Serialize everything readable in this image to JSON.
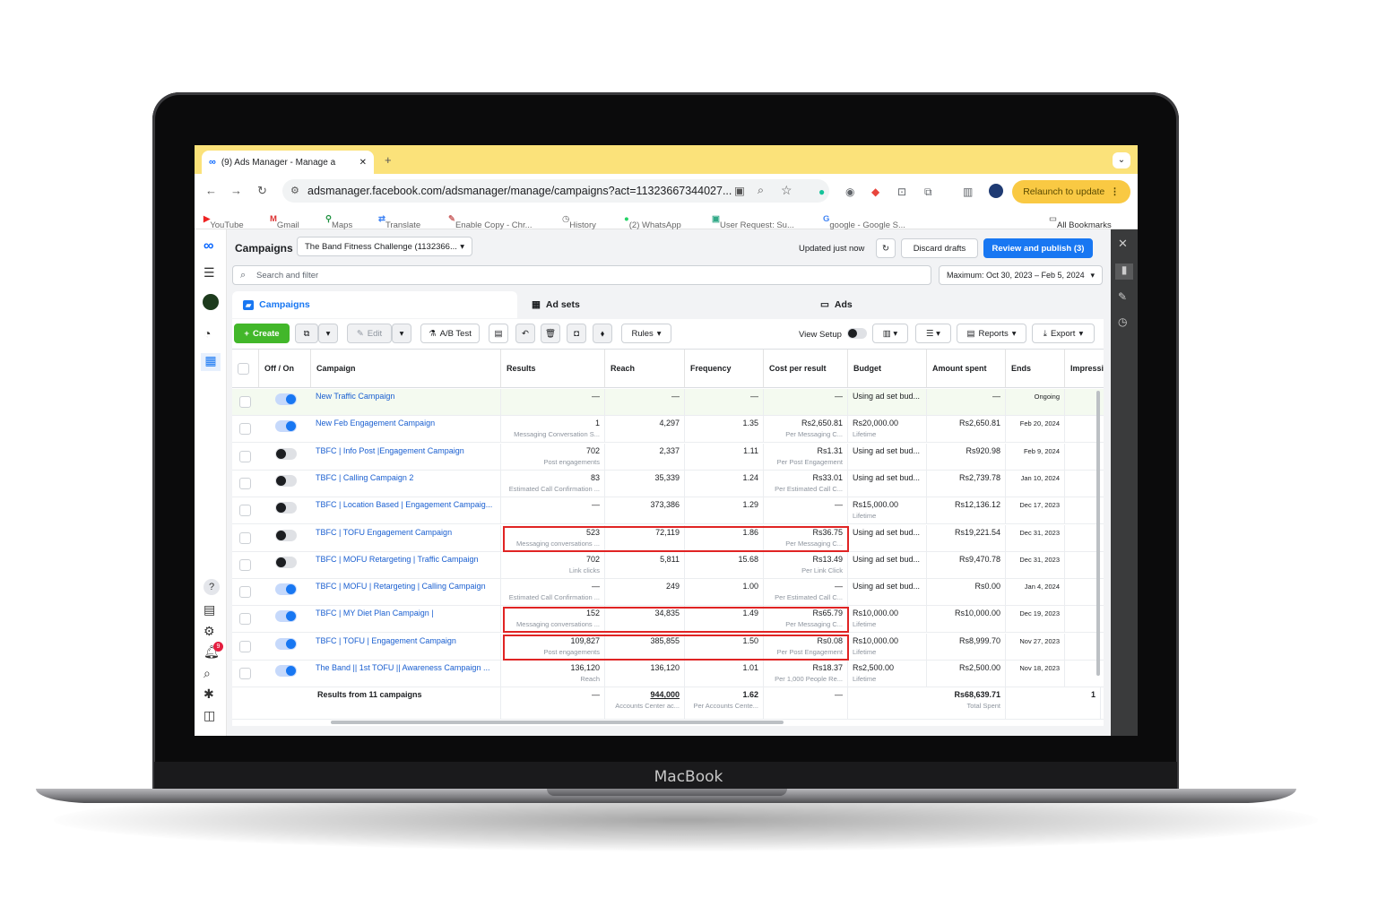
{
  "device": {
    "brand": "MacBook"
  },
  "browser": {
    "tab_title": "(9) Ads Manager - Manage a",
    "url": "adsmanager.facebook.com/adsmanager/manage/campaigns?act=11323667344027...",
    "relaunch_label": "Relaunch to update",
    "bookmarks": [
      "YouTube",
      "Gmail",
      "Maps",
      "Translate",
      "Enable Copy - Chr...",
      "History",
      "(2) WhatsApp",
      "User Request: Su...",
      "google - Google S..."
    ],
    "all_bookmarks": "All Bookmarks"
  },
  "header": {
    "title": "Campaigns",
    "account": "The Band Fitness Challenge (1132366...",
    "updated": "Updated just now",
    "discard": "Discard drafts",
    "publish": "Review and publish (3)",
    "more": "···"
  },
  "search": {
    "placeholder": "Search and filter"
  },
  "date_range": "Maximum: Oct 30, 2023 – Feb 5, 2024",
  "level_tabs": {
    "campaigns": "Campaigns",
    "adsets": "Ad sets",
    "ads": "Ads"
  },
  "toolbar": {
    "create": "Create",
    "edit": "Edit",
    "ab_test": "A/B Test",
    "rules": "Rules",
    "view_setup": "View Setup",
    "reports": "Reports",
    "export": "Export"
  },
  "columns": {
    "off_on": "Off / On",
    "campaign": "Campaign",
    "results": "Results",
    "reach": "Reach",
    "frequency": "Frequency",
    "cost_per_result": "Cost per result",
    "budget": "Budget",
    "amount_spent": "Amount spent",
    "ends": "Ends",
    "impressions": "Impressio"
  },
  "rows": [
    {
      "on": true,
      "name": "New Traffic Campaign",
      "results": "—",
      "results_sub": "",
      "reach": "—",
      "frequency": "—",
      "cpr": "—",
      "cpr_sub": "",
      "budget": "Using ad set bud...",
      "budget_sub": "",
      "spent": "—",
      "ends": "Ongoing"
    },
    {
      "on": true,
      "name": "New Feb Engagement Campaign",
      "results": "1",
      "results_sub": "Messaging Conversation S...",
      "reach": "4,297",
      "frequency": "1.35",
      "cpr": "Rs2,650.81",
      "cpr_sub": "Per Messaging C...",
      "budget": "Rs20,000.00",
      "budget_sub": "Lifetime",
      "spent": "Rs2,650.81",
      "ends": "Feb 20, 2024"
    },
    {
      "on": false,
      "name": "TBFC | Info Post |Engagement Campaign",
      "results": "702",
      "results_sub": "Post engagements",
      "reach": "2,337",
      "frequency": "1.11",
      "cpr": "Rs1.31",
      "cpr_sub": "Per Post Engagement",
      "budget": "Using ad set bud...",
      "budget_sub": "",
      "spent": "Rs920.98",
      "ends": "Feb 9, 2024"
    },
    {
      "on": false,
      "name": "TBFC | Calling Campaign 2",
      "results": "83",
      "results_sub": "Estimated Call Confirmation ...",
      "reach": "35,339",
      "frequency": "1.24",
      "cpr": "Rs33.01",
      "cpr_sub": "Per Estimated Call C...",
      "budget": "Using ad set bud...",
      "budget_sub": "",
      "spent": "Rs2,739.78",
      "ends": "Jan 10, 2024"
    },
    {
      "on": false,
      "name": "TBFC | Location Based | Engagement Campaig...",
      "results": "—",
      "results_sub": "",
      "reach": "373,386",
      "frequency": "1.29",
      "cpr": "—",
      "cpr_sub": "",
      "budget": "Rs15,000.00",
      "budget_sub": "Lifetime",
      "spent": "Rs12,136.12",
      "ends": "Dec 17, 2023"
    },
    {
      "on": false,
      "name": "TBFC | TOFU Engagement Campaign",
      "results": "523",
      "results_sub": "Messaging conversations ...",
      "reach": "72,119",
      "frequency": "1.86",
      "cpr": "Rs36.75",
      "cpr_sub": "Per Messaging C...",
      "budget": "Using ad set bud...",
      "budget_sub": "",
      "spent": "Rs19,221.54",
      "ends": "Dec 31, 2023"
    },
    {
      "on": false,
      "name": "TBFC | MOFU Retargeting | Traffic Campaign",
      "results": "702",
      "results_sub": "Link clicks",
      "reach": "5,811",
      "frequency": "15.68",
      "cpr": "Rs13.49",
      "cpr_sub": "Per Link Click",
      "budget": "Using ad set bud...",
      "budget_sub": "",
      "spent": "Rs9,470.78",
      "ends": "Dec 31, 2023"
    },
    {
      "on": true,
      "name": "TBFC | MOFU | Retargeting | Calling Campaign",
      "results": "—",
      "results_sub": "Estimated Call Confirmation ...",
      "reach": "249",
      "frequency": "1.00",
      "cpr": "—",
      "cpr_sub": "Per Estimated Call C...",
      "budget": "Using ad set bud...",
      "budget_sub": "",
      "spent": "Rs0.00",
      "ends": "Jan 4, 2024"
    },
    {
      "on": true,
      "name": "TBFC | MY Diet Plan Campaign |",
      "results": "152",
      "results_sub": "Messaging conversations ...",
      "reach": "34,835",
      "frequency": "1.49",
      "cpr": "Rs65.79",
      "cpr_sub": "Per Messaging C...",
      "budget": "Rs10,000.00",
      "budget_sub": "Lifetime",
      "spent": "Rs10,000.00",
      "ends": "Dec 19, 2023"
    },
    {
      "on": true,
      "name": "TBFC | TOFU | Engagement Campaign",
      "results": "109,827",
      "results_sub": "Post engagements",
      "reach": "385,855",
      "frequency": "1.50",
      "cpr": "Rs0.08",
      "cpr_sub": "Per Post Engagement",
      "budget": "Rs10,000.00",
      "budget_sub": "Lifetime",
      "spent": "Rs8,999.70",
      "ends": "Nov 27, 2023"
    },
    {
      "on": true,
      "name": "The Band || 1st TOFU || Awareness Campaign ...",
      "results": "136,120",
      "results_sub": "Reach",
      "reach": "136,120",
      "frequency": "1.01",
      "cpr": "Rs18.37",
      "cpr_sub": "Per 1,000 People Re...",
      "budget": "Rs2,500.00",
      "budget_sub": "Lifetime",
      "spent": "Rs2,500.00",
      "ends": "Nov 18, 2023"
    }
  ],
  "totals": {
    "label": "Results from 11 campaigns",
    "results": "—",
    "reach": "944,000",
    "reach_sub": "Accounts Center ac...",
    "frequency": "1.62",
    "frequency_sub": "Per Accounts Cente...",
    "cpr": "—",
    "spent": "Rs68,639.71",
    "spent_sub": "Total Spent",
    "impressions": "1"
  },
  "notification_count": "9"
}
